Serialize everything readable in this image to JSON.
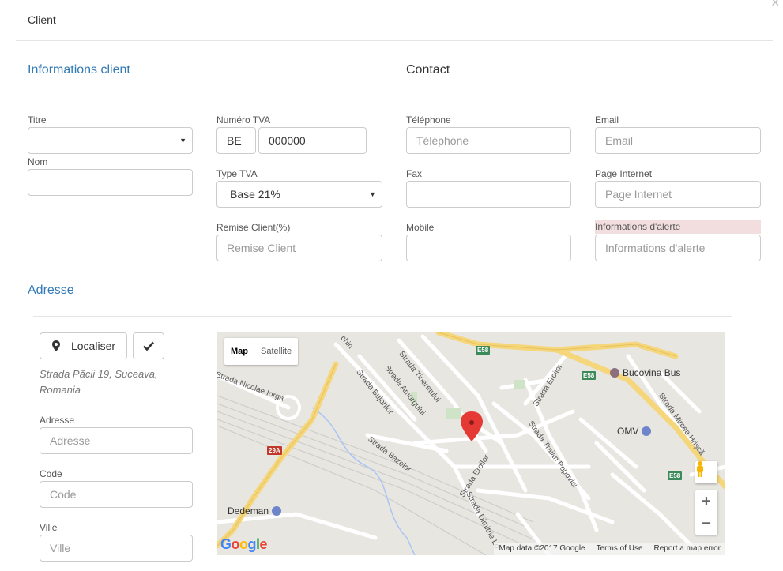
{
  "modal": {
    "title": "Client"
  },
  "sections": {
    "client_info": "Informations client",
    "contact": "Contact",
    "address": "Adresse"
  },
  "client": {
    "titre": {
      "label": "Titre",
      "value": ""
    },
    "nom": {
      "label": "Nom",
      "value": ""
    },
    "tva": {
      "label": "Numéro TVA",
      "country": "BE",
      "number": "000000"
    },
    "type_tva": {
      "label": "Type TVA",
      "value": "Base 21%"
    },
    "remise": {
      "label": "Remise Client(%)",
      "placeholder": "Remise Client"
    }
  },
  "contact": {
    "telephone": {
      "label": "Téléphone",
      "placeholder": "Téléphone"
    },
    "email": {
      "label": "Email",
      "placeholder": "Email"
    },
    "fax": {
      "label": "Fax",
      "placeholder": ""
    },
    "page_internet": {
      "label": "Page Internet",
      "placeholder": "Page Internet"
    },
    "mobile": {
      "label": "Mobile",
      "placeholder": ""
    },
    "alerte": {
      "label": "Informations d'alerte",
      "placeholder": "Informations d'alerte"
    }
  },
  "address": {
    "localiser_label": "Localiser",
    "geo_line1": "Strada Păcii 19, Suceava,",
    "geo_line2": "Romania",
    "adresse": {
      "label": "Adresse",
      "placeholder": "Adresse"
    },
    "code": {
      "label": "Code",
      "placeholder": "Code"
    },
    "ville": {
      "label": "Ville",
      "placeholder": "Ville"
    }
  },
  "map": {
    "type_map": "Map",
    "type_satellite": "Satellite",
    "zoom_in": "+",
    "zoom_out": "−",
    "footer_data": "Map data ©2017 Google",
    "footer_terms": "Terms of Use",
    "footer_report": "Report a map error",
    "logo": "Google",
    "labels": {
      "tineretului": "Strada Tineretului",
      "amurgului": "Strada Amurgului",
      "bujorilor": "Strada Bujorilor",
      "nicolae_iorga": "Strada Nicolae Iorga",
      "bazelor": "Strada Bazelor",
      "eroilor_top": "Strada Eroilor",
      "eroilor_center": "Strada Eroilor",
      "traian": "Strada Traian Popovici",
      "dimitrie": "Strada Dimitrie Lo",
      "mircea": "Strada Mircea Hrișcă",
      "chin": "chin"
    },
    "badges": {
      "e58": "E58",
      "r29a": "29A"
    },
    "poi": {
      "bucovina": "Bucovina Bus",
      "omv": "OMV",
      "dedeman": "Dedeman"
    },
    "colors": {
      "background": "#e8e6e1",
      "highway": "#f5d67b",
      "street": "#ffffff",
      "marker": "#e53935"
    }
  }
}
